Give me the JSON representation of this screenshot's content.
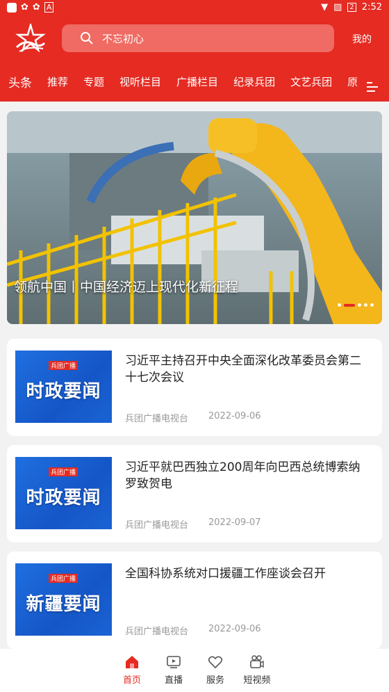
{
  "status_bar": {
    "time": "2:52",
    "battery": "2"
  },
  "header": {
    "search_placeholder": "不忘初心",
    "mine_label": "我的"
  },
  "tabs": [
    "头条",
    "推荐",
    "专题",
    "视听栏目",
    "广播栏目",
    "纪录兵团",
    "文艺兵团",
    "原"
  ],
  "banner": {
    "title": "领航中国丨中国经济迈上现代化新征程"
  },
  "news": [
    {
      "thumb_text": "时政要闻",
      "thumb_brand": "兵团广播",
      "title": "习近平主持召开中央全面深化改革委员会第二十七次会议",
      "source": "兵团广播电视台",
      "date": "2022-09-06"
    },
    {
      "thumb_text": "时政要闻",
      "thumb_brand": "兵团广播",
      "title": "习近平就巴西独立200周年向巴西总统博索纳罗致贺电",
      "source": "兵团广播电视台",
      "date": "2022-09-07"
    },
    {
      "thumb_text": "新疆要闻",
      "thumb_brand": "兵团广播",
      "title": "全国科协系统对口援疆工作座谈会召开",
      "source": "兵团广播电视台",
      "date": "2022-09-06"
    }
  ],
  "bottom_nav": [
    {
      "label": "首页",
      "icon": "home-icon",
      "active": true
    },
    {
      "label": "直播",
      "icon": "live-tv-icon",
      "active": false
    },
    {
      "label": "服务",
      "icon": "heart-icon",
      "active": false
    },
    {
      "label": "短视频",
      "icon": "video-camera-icon",
      "active": false
    }
  ],
  "colors": {
    "brand_red": "#e52b22"
  }
}
